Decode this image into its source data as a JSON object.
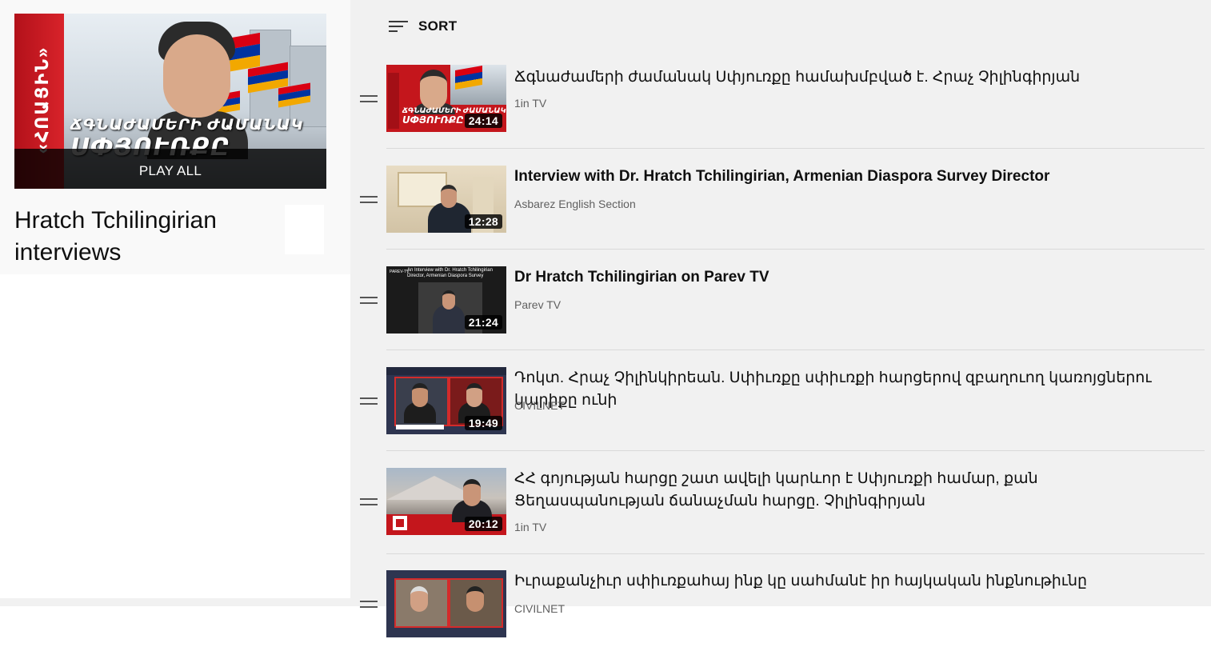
{
  "playlist": {
    "title": "Hratch Tchilingirian interviews",
    "play_all_label": "PLAY ALL",
    "hero": {
      "brand": "«ՀՈԱՑԻՆ»",
      "headline_line1": "ՃԳՆԱԺԱՄԵՐԻ ԺԱՄԱՆԱԿ",
      "headline_line2": "ՍՓՅՈՒՌՔԸ"
    }
  },
  "toolbar": {
    "sort_label": "SORT"
  },
  "videos": [
    {
      "title": "Ճգնաժամերի ժամանակ Սփյուռքը համախմբված է. Հրաչ Չիլինգիրյան",
      "channel": "1in TV",
      "duration": "24:14",
      "thumb_text1": "ՃԳՆԱԺԱՄԵՐԻ ԺԱՄԱՆԱԿ",
      "thumb_text2": "ՍՓՅՈՒՌՔԸ"
    },
    {
      "title": "Interview with Dr. Hratch Tchilingirian, Armenian Diaspora Survey Director",
      "channel": "Asbarez English Section",
      "duration": "12:28"
    },
    {
      "title": "Dr Hratch Tchilingirian on Parev TV",
      "channel": "Parev TV",
      "duration": "21:24",
      "thumb_text": "An Interview with Dr. Hratch Tchilingirian Director, Armenian Diaspora Survey",
      "thumb_side": "PAREV-TV"
    },
    {
      "title": "Դոկտ. Հրաչ Չիլինկիրեան. Սփիւռքը սփիւռքի հարցերով զբաղուող կառոյցներու կարիքը ունի",
      "channel": "CIVILNET",
      "duration": "19:49"
    },
    {
      "title": "ՀՀ գոյության հարցը շատ ավելի կարևոր է Սփյուռքի համար, քան Ցեղասպանության ճանաչման հարցը. Չիլինգիրյան",
      "channel": "1in TV",
      "duration": "20:12"
    },
    {
      "title": "Իւրաքանչիւր սփիւռքահայ ինք կը սահմանէ իր հայկական ինքնութիւնը",
      "channel": "CIVILNET",
      "duration": ""
    }
  ]
}
